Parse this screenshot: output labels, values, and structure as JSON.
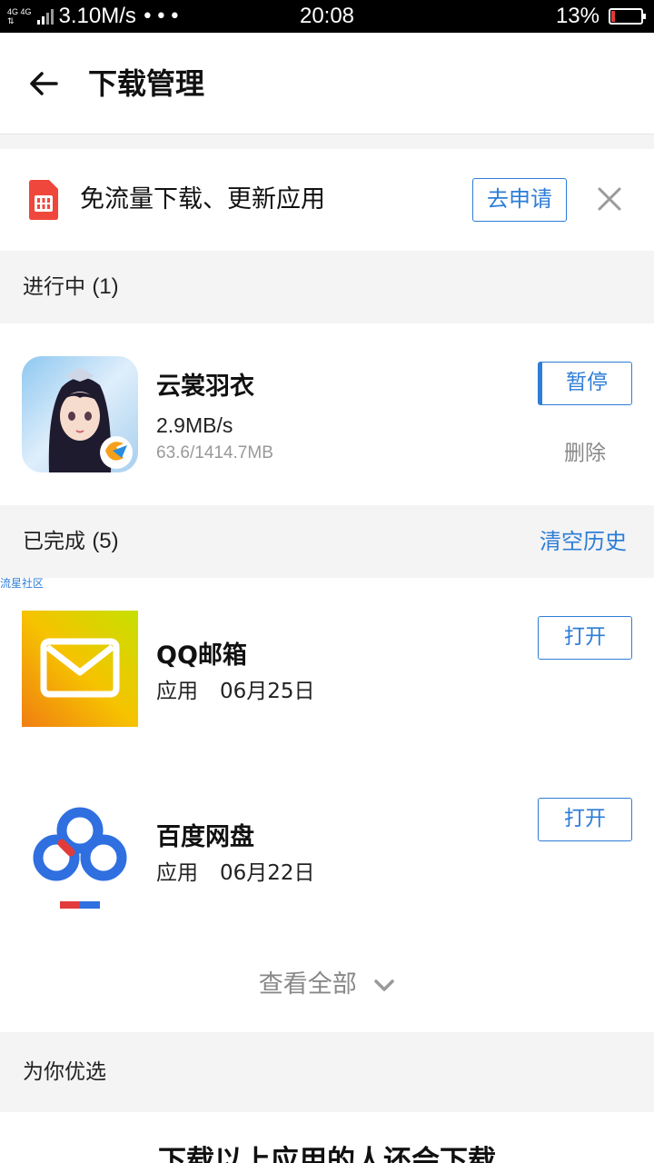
{
  "status_bar": {
    "network_top": "4G 4G",
    "speed": "3.10M/s",
    "dots": "•••",
    "time": "20:08",
    "battery_percent": "13%",
    "battery_level": 0.13,
    "battery_color": "#e53935"
  },
  "header": {
    "back_icon": "arrow-left-icon",
    "title": "下载管理"
  },
  "promo": {
    "icon": "sim-card-icon",
    "text": "免流量下载、更新应用",
    "button_label": "去申请",
    "close_icon": "close-icon"
  },
  "in_progress": {
    "title": "进行中",
    "count": "(1)",
    "items": [
      {
        "name": "云裳羽衣",
        "speed": "2.9MB/s",
        "progress": "63.6/1414.7MB",
        "pause_label": "暂停",
        "delete_label": "删除"
      }
    ]
  },
  "completed": {
    "title": "已完成",
    "count": "(5)",
    "clear_label": "清空历史",
    "watermark": "流星社区",
    "items": [
      {
        "name": "QQ邮箱",
        "type": "应用",
        "date": "06月25日",
        "open_label": "打开"
      },
      {
        "name": "百度网盘",
        "type": "应用",
        "date": "06月22日",
        "open_label": "打开"
      }
    ],
    "view_all_label": "查看全部"
  },
  "recommend": {
    "title": "为你优选",
    "subtitle": "下载以上应用的人还会下载"
  },
  "colors": {
    "accent": "#2e7dd6",
    "background": "#f4f4f4"
  }
}
